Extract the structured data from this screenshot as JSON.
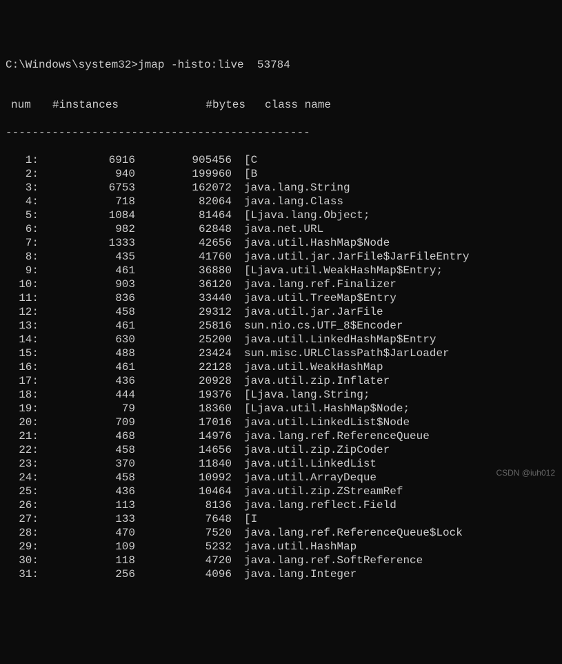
{
  "prompt": {
    "path": "C:\\Windows\\system32>",
    "command": "jmap -histo:live  53784"
  },
  "headers": {
    "num": "num",
    "instances": "#instances",
    "bytes": "#bytes",
    "class_name": "class name"
  },
  "separator": "----------------------------------------------",
  "rows": [
    {
      "num": "1:",
      "instances": "6916",
      "bytes": "905456",
      "class": "[C"
    },
    {
      "num": "2:",
      "instances": "940",
      "bytes": "199960",
      "class": "[B"
    },
    {
      "num": "3:",
      "instances": "6753",
      "bytes": "162072",
      "class": "java.lang.String"
    },
    {
      "num": "4:",
      "instances": "718",
      "bytes": "82064",
      "class": "java.lang.Class"
    },
    {
      "num": "5:",
      "instances": "1084",
      "bytes": "81464",
      "class": "[Ljava.lang.Object;"
    },
    {
      "num": "6:",
      "instances": "982",
      "bytes": "62848",
      "class": "java.net.URL"
    },
    {
      "num": "7:",
      "instances": "1333",
      "bytes": "42656",
      "class": "java.util.HashMap$Node"
    },
    {
      "num": "8:",
      "instances": "435",
      "bytes": "41760",
      "class": "java.util.jar.JarFile$JarFileEntry"
    },
    {
      "num": "9:",
      "instances": "461",
      "bytes": "36880",
      "class": "[Ljava.util.WeakHashMap$Entry;"
    },
    {
      "num": "10:",
      "instances": "903",
      "bytes": "36120",
      "class": "java.lang.ref.Finalizer"
    },
    {
      "num": "11:",
      "instances": "836",
      "bytes": "33440",
      "class": "java.util.TreeMap$Entry"
    },
    {
      "num": "12:",
      "instances": "458",
      "bytes": "29312",
      "class": "java.util.jar.JarFile"
    },
    {
      "num": "13:",
      "instances": "461",
      "bytes": "25816",
      "class": "sun.nio.cs.UTF_8$Encoder"
    },
    {
      "num": "14:",
      "instances": "630",
      "bytes": "25200",
      "class": "java.util.LinkedHashMap$Entry"
    },
    {
      "num": "15:",
      "instances": "488",
      "bytes": "23424",
      "class": "sun.misc.URLClassPath$JarLoader"
    },
    {
      "num": "16:",
      "instances": "461",
      "bytes": "22128",
      "class": "java.util.WeakHashMap"
    },
    {
      "num": "17:",
      "instances": "436",
      "bytes": "20928",
      "class": "java.util.zip.Inflater"
    },
    {
      "num": "18:",
      "instances": "444",
      "bytes": "19376",
      "class": "[Ljava.lang.String;"
    },
    {
      "num": "19:",
      "instances": "79",
      "bytes": "18360",
      "class": "[Ljava.util.HashMap$Node;"
    },
    {
      "num": "20:",
      "instances": "709",
      "bytes": "17016",
      "class": "java.util.LinkedList$Node"
    },
    {
      "num": "21:",
      "instances": "468",
      "bytes": "14976",
      "class": "java.lang.ref.ReferenceQueue"
    },
    {
      "num": "22:",
      "instances": "458",
      "bytes": "14656",
      "class": "java.util.zip.ZipCoder"
    },
    {
      "num": "23:",
      "instances": "370",
      "bytes": "11840",
      "class": "java.util.LinkedList"
    },
    {
      "num": "24:",
      "instances": "458",
      "bytes": "10992",
      "class": "java.util.ArrayDeque"
    },
    {
      "num": "25:",
      "instances": "436",
      "bytes": "10464",
      "class": "java.util.zip.ZStreamRef"
    },
    {
      "num": "26:",
      "instances": "113",
      "bytes": "8136",
      "class": "java.lang.reflect.Field"
    },
    {
      "num": "27:",
      "instances": "133",
      "bytes": "7648",
      "class": "[I"
    },
    {
      "num": "28:",
      "instances": "470",
      "bytes": "7520",
      "class": "java.lang.ref.ReferenceQueue$Lock"
    },
    {
      "num": "29:",
      "instances": "109",
      "bytes": "5232",
      "class": "java.util.HashMap"
    },
    {
      "num": "30:",
      "instances": "118",
      "bytes": "4720",
      "class": "java.lang.ref.SoftReference"
    },
    {
      "num": "31:",
      "instances": "256",
      "bytes": "4096",
      "class": "java.lang.Integer"
    }
  ],
  "watermark": "CSDN @iuh012"
}
